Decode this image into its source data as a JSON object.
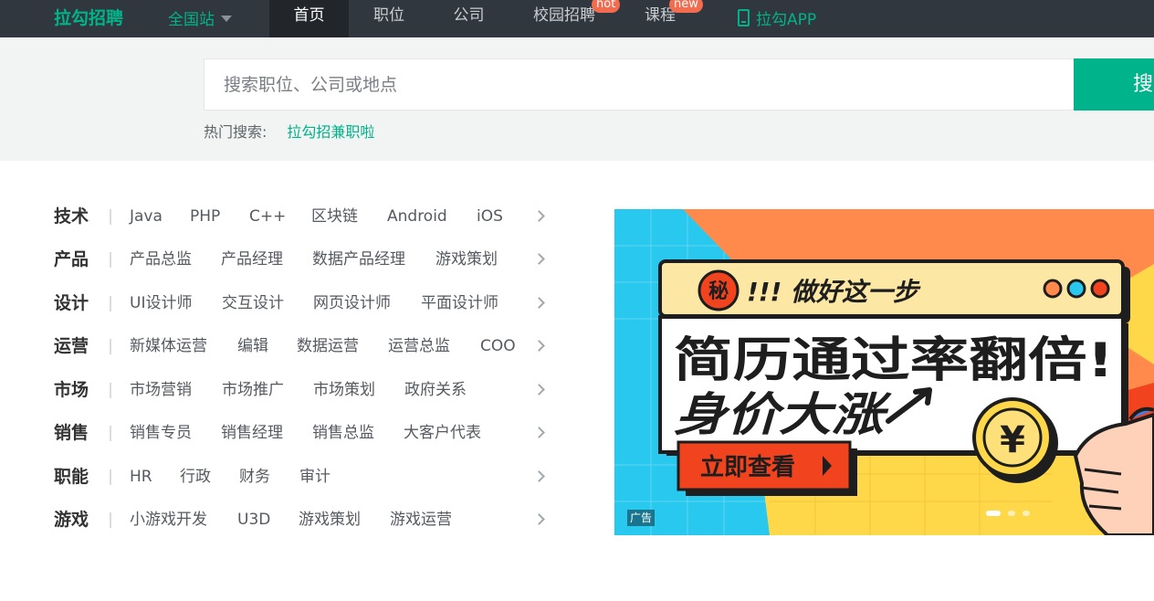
{
  "nav": {
    "logo": "拉勾招聘",
    "city": "全国站",
    "items": [
      {
        "label": "首页",
        "active": true
      },
      {
        "label": "职位"
      },
      {
        "label": "公司"
      },
      {
        "label": "校园招聘",
        "badge": "hot"
      },
      {
        "label": "课程",
        "badge": "new"
      }
    ],
    "app_label": "拉勾APP"
  },
  "search": {
    "placeholder": "搜索职位、公司或地点",
    "button_label": "搜",
    "hot_label": "热门搜索:",
    "hot_links": [
      "拉勾招兼职啦"
    ]
  },
  "categories": [
    {
      "title": "技术",
      "items": [
        "Java",
        "PHP",
        "C++",
        "区块链",
        "Android",
        "iOS"
      ]
    },
    {
      "title": "产品",
      "items": [
        "产品总监",
        "产品经理",
        "数据产品经理",
        "游戏策划"
      ]
    },
    {
      "title": "设计",
      "items": [
        "UI设计师",
        "交互设计",
        "网页设计师",
        "平面设计师"
      ]
    },
    {
      "title": "运营",
      "items": [
        "新媒体运营",
        "编辑",
        "数据运营",
        "运营总监",
        "COO"
      ]
    },
    {
      "title": "市场",
      "items": [
        "市场营销",
        "市场推广",
        "市场策划",
        "政府关系"
      ]
    },
    {
      "title": "销售",
      "items": [
        "销售专员",
        "销售经理",
        "销售总监",
        "大客户代表"
      ]
    },
    {
      "title": "职能",
      "items": [
        "HR",
        "行政",
        "财务",
        "审计"
      ]
    },
    {
      "title": "游戏",
      "items": [
        "小游戏开发",
        "U3D",
        "游戏策划",
        "游戏运营"
      ]
    }
  ],
  "banner": {
    "secret_char": "秘",
    "top_text": "!!! 做好这一步",
    "headline": "简历通过率翻倍!",
    "subline": "身价大涨",
    "cta": "立即查看",
    "coin_symbol": "¥",
    "ad_tag": "广告",
    "slides_total": 3,
    "slide_active": 1,
    "colors": {
      "sky": "#29c8ee",
      "orange": "#ff8a4c",
      "yellow": "#ffd84a",
      "red": "#f2431f",
      "dark": "#1e1e1e"
    }
  }
}
